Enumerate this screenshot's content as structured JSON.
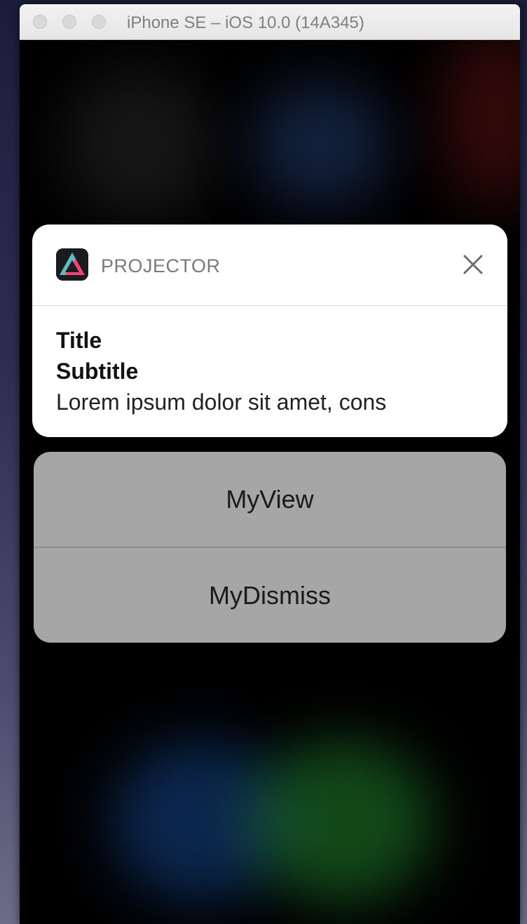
{
  "window": {
    "title": "iPhone SE – iOS 10.0 (14A345)"
  },
  "notification": {
    "app_name": "PROJECTOR",
    "app_icon": "projector-app-icon",
    "close_icon": "close-icon",
    "title": "Title",
    "subtitle": "Subtitle",
    "body": "Lorem ipsum dolor sit amet, cons"
  },
  "actions": [
    {
      "label": "MyView"
    },
    {
      "label": "MyDismiss"
    }
  ],
  "colors": {
    "card_bg": "#ffffff",
    "actions_bg": "#a6a6a6",
    "icon_accent_pink": "#f0456e",
    "icon_accent_teal": "#4ad0d0"
  }
}
